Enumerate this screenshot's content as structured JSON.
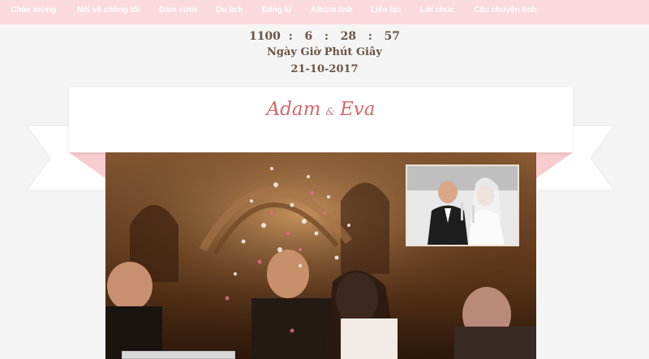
{
  "nav": {
    "items": [
      "Chào mừng",
      "Nói về chồng tôi",
      "Đám cưới",
      "Du lịch",
      "Đăng kí",
      "Album ảnh",
      "Liên lạc",
      "Lời chúc",
      "Câu chuyện tình"
    ]
  },
  "countdown": {
    "days": "1100",
    "hours": "6",
    "minutes": "28",
    "seconds": "57",
    "units_label": "Ngày Giờ Phút Giây",
    "date": "21-10-2017"
  },
  "couple": {
    "groom": "Adam",
    "amp": "&",
    "bride": "Eva"
  },
  "colors": {
    "nav_bg": "#fadadd",
    "ribbon_pink": "#f7cdd0",
    "name_color": "#d3676c",
    "countdown_color": "#6b5442"
  }
}
